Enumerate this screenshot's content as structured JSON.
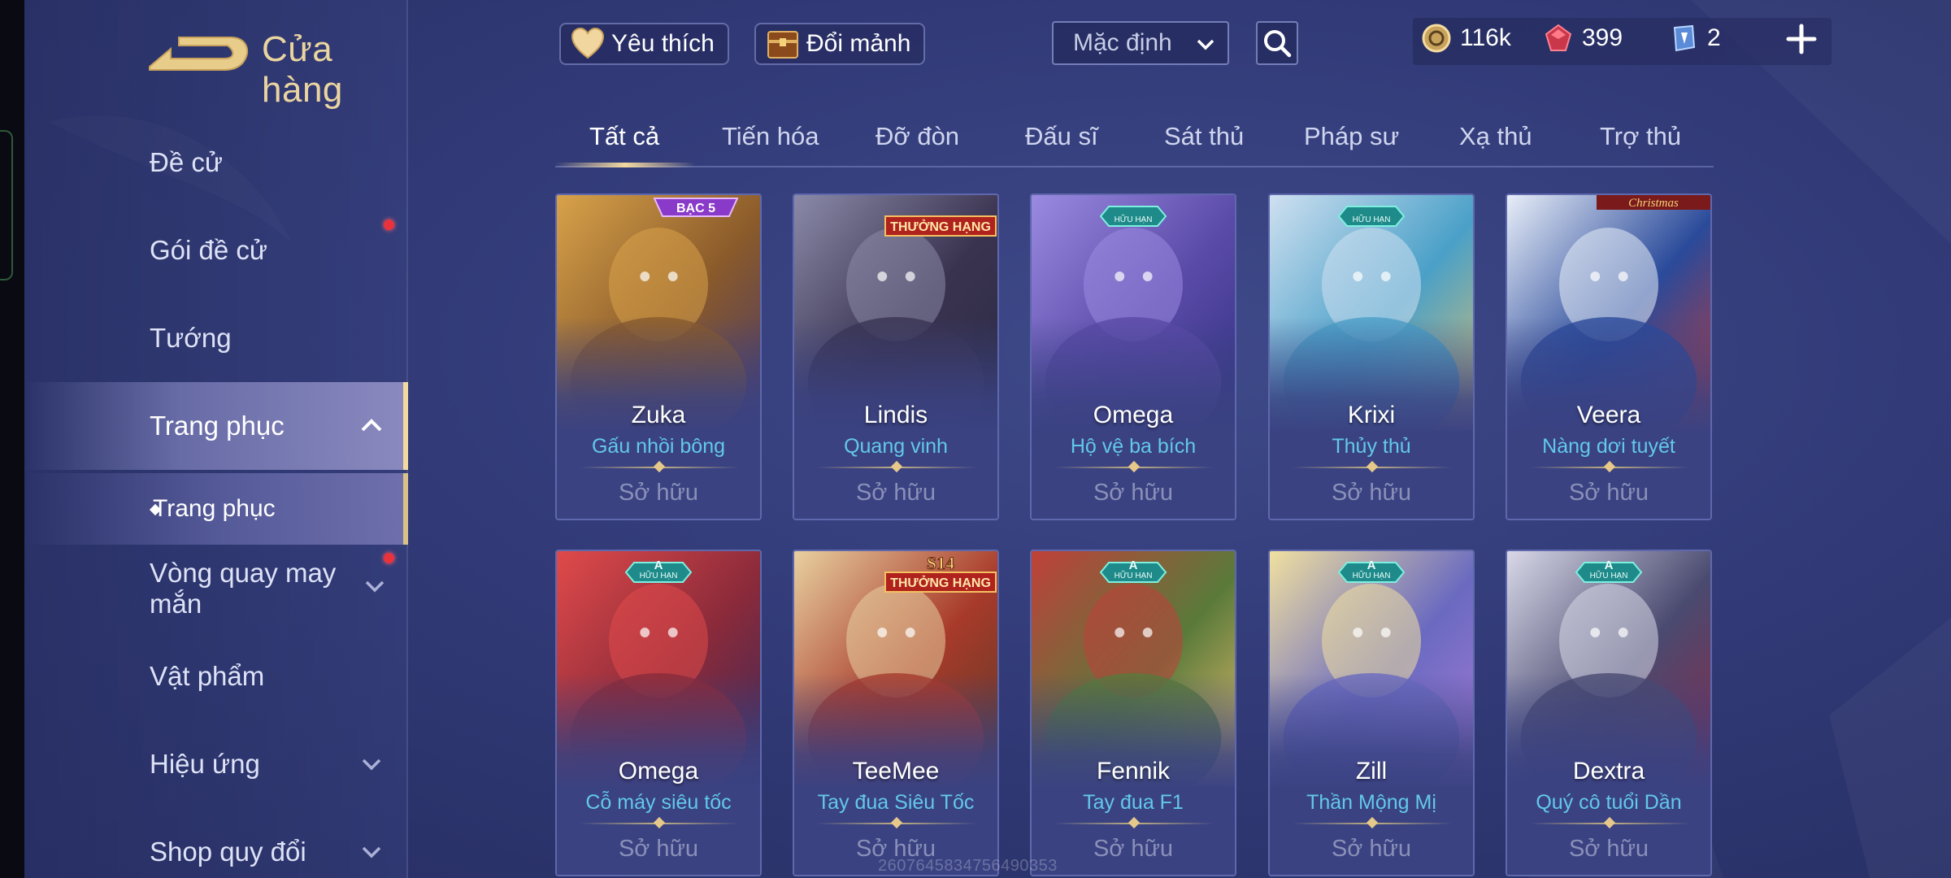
{
  "header": {
    "title": "Cửa hàng",
    "favorite_label": "Yêu thích",
    "exchange_label": "Đổi mảnh",
    "sort_value": "Mặc định"
  },
  "currency": {
    "gold": "116k",
    "rubies": "399",
    "vouchers": "2"
  },
  "sidebar": {
    "items": [
      {
        "label": "Đề cử"
      },
      {
        "label": "Gói đề cử"
      },
      {
        "label": "Tướng"
      },
      {
        "label": "Trang phục"
      },
      {
        "label": "Vòng quay may mắn"
      },
      {
        "label": "Vật phẩm"
      },
      {
        "label": "Hiệu ứng"
      },
      {
        "label": "Shop quy đổi"
      }
    ],
    "sub_item": "Trang phục"
  },
  "tabs": [
    "Tất cả",
    "Tiến hóa",
    "Đỡ đòn",
    "Đấu sĩ",
    "Sát thủ",
    "Pháp sư",
    "Xạ thủ",
    "Trợ thủ"
  ],
  "cards": [
    {
      "hero": "Zuka",
      "skin": "Gấu nhồi bông",
      "status": "Sở hữu",
      "badge": "BẠC 5",
      "badge_type": "rank"
    },
    {
      "hero": "Lindis",
      "skin": "Quang vinh",
      "status": "Sở hữu",
      "badge": "THƯỞNG HẠNG",
      "badge_type": "reward"
    },
    {
      "hero": "Omega",
      "skin": "Hộ vệ ba bích",
      "status": "Sở hữu",
      "badge": "HỮU HẠN",
      "badge_type": "limited"
    },
    {
      "hero": "Krixi",
      "skin": "Thủy thủ",
      "status": "Sở hữu",
      "badge": "HỮU HẠN",
      "badge_type": "limited"
    },
    {
      "hero": "Veera",
      "skin": "Nàng dơi tuyết",
      "status": "Sở hữu",
      "badge": "Christmas",
      "badge_type": "christmas"
    },
    {
      "hero": "Omega",
      "skin": "Cỗ máy siêu tốc",
      "status": "Sở hữu",
      "badge": "HỮU HẠN",
      "badge_grade": "A",
      "badge_type": "limited"
    },
    {
      "hero": "TeeMee",
      "skin": "Tay đua Siêu Tốc",
      "status": "Sở hữu",
      "badge": "THƯỞNG HẠNG",
      "badge_season": "S14",
      "badge_type": "reward"
    },
    {
      "hero": "Fennik",
      "skin": "Tay đua F1",
      "status": "Sở hữu",
      "badge": "HỮU HẠN",
      "badge_grade": "A",
      "badge_type": "limited"
    },
    {
      "hero": "Zill",
      "skin": "Thần Mộng Mị",
      "status": "Sở hữu",
      "badge": "HỮU HẠN",
      "badge_grade": "A",
      "badge_type": "limited"
    },
    {
      "hero": "Dextra",
      "skin": "Quý cô tuổi Dần",
      "status": "Sở hữu",
      "badge": "HỮU HẠN",
      "badge_grade": "A",
      "badge_type": "limited"
    }
  ],
  "watermark": "2607645834756490353",
  "colors": {
    "accent_gold": "#f3d9a0",
    "skin_name": "#63c8ea",
    "notification": "#e8323c"
  }
}
